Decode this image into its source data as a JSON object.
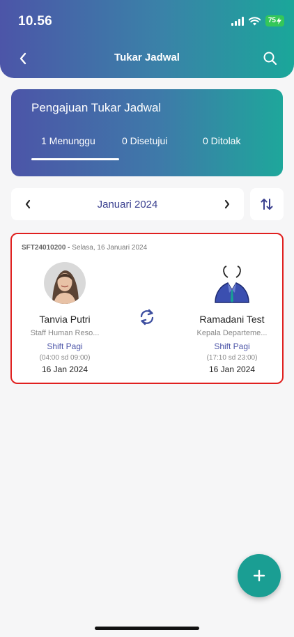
{
  "status_bar": {
    "time": "10.56",
    "battery": "75"
  },
  "header": {
    "title": "Tukar Jadwal"
  },
  "summary": {
    "title": "Pengajuan Tukar Jadwal",
    "tabs": [
      {
        "label": "1 Menunggu"
      },
      {
        "label": "0 Disetujui"
      },
      {
        "label": "0 Ditolak"
      }
    ]
  },
  "month_selector": {
    "label": "Januari 2024"
  },
  "requests": [
    {
      "id": "SFT24010200 -",
      "date": "Selasa, 16 Januari 2024",
      "from": {
        "name": "Tanvia Putri",
        "role": "Staff Human Reso...",
        "shift": "Shift Pagi",
        "hours": "(04:00 sd 09:00)",
        "date": "16 Jan 2024"
      },
      "to": {
        "name": "Ramadani Test",
        "role": "Kepala Departeme...",
        "shift": "Shift Pagi",
        "hours": "(17:10 sd 23:00)",
        "date": "16 Jan 2024"
      }
    }
  ],
  "icons": {
    "back": "chevron-left-icon",
    "search": "search-icon",
    "prev": "chevron-left-icon",
    "next": "chevron-right-icon",
    "sort": "sort-arrows-icon",
    "swap": "swap-icon",
    "add": "plus-icon"
  },
  "colors": {
    "accent": "#4c55a8",
    "teal": "#1a9e93",
    "highlight_border": "#e0201f"
  }
}
